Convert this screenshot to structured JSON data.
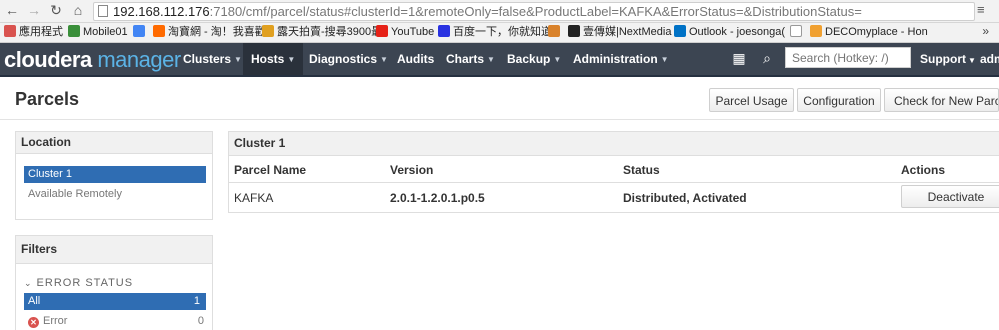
{
  "browser": {
    "url_main": "192.168.112.176",
    "url_rest": ":7180/cmf/parcel/status#clusterId=1&remoteOnly=false&ProductLabel=KAFKA&ErrorStatus=&DistributionStatus=",
    "bookmarks": [
      {
        "label": "應用程式",
        "color": "#d9534f"
      },
      {
        "label": "Mobile01",
        "color": "#3a8f3a"
      },
      {
        "label": "",
        "color": "#4285f4"
      },
      {
        "label": "淘寶網 - 淘！我喜歡",
        "color": "#ff6a00"
      },
      {
        "label": "露天拍賣-搜尋3900最",
        "color": "#e0a020"
      },
      {
        "label": "YouTube",
        "color": "#e62117"
      },
      {
        "label": "百度一下，你就知道",
        "color": "#2932e1"
      },
      {
        "label": "",
        "color": "#d9822b"
      },
      {
        "label": "壹傳媒|NextMedia",
        "color": "#222222"
      },
      {
        "label": "Outlook - joesonga(",
        "color": "#0072c6"
      },
      {
        "label": "",
        "color": "#bbbbbb"
      },
      {
        "label": "DECOmyplace - Hon",
        "color": "#f0a030"
      }
    ],
    "more": "»"
  },
  "cm": {
    "logo_a": "cloudera",
    "logo_b": "manager",
    "menus": [
      "Clusters",
      "Hosts",
      "Diagnostics",
      "Audits",
      "Charts",
      "Backup",
      "Administration"
    ],
    "search_placeholder": "Search (Hotkey: /)",
    "support": "Support",
    "user": "adm"
  },
  "page": {
    "title": "Parcels",
    "buttons": [
      "Parcel Usage",
      "Configuration",
      "Check for New Parcels"
    ]
  },
  "location": {
    "title": "Location",
    "selected": "Cluster 1",
    "other": "Available Remotely"
  },
  "filters": {
    "title": "Filters",
    "section": "ERROR STATUS",
    "all_label": "All",
    "all_count": "1",
    "error_label": "Error",
    "error_count": "0"
  },
  "cluster": {
    "title": "Cluster 1",
    "headers": [
      "Parcel Name",
      "Version",
      "Status",
      "Actions"
    ],
    "row": {
      "name": "KAFKA",
      "version": "2.0.1-1.2.0.1.p0.5",
      "status": "Distributed, Activated",
      "action": "Deactivate"
    }
  },
  "colors": {
    "accent": "#2f6db3",
    "navbar": "#3c4552",
    "error": "#d9534f"
  }
}
